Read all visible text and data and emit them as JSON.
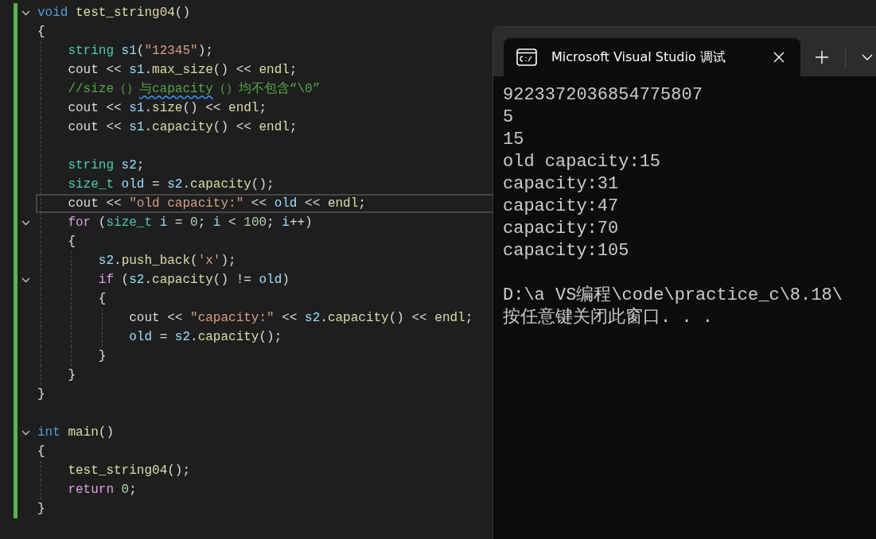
{
  "editor": {
    "lines": [
      {
        "kind": "code",
        "fold": true,
        "tokens": [
          {
            "kind": "keyword",
            "text": "void"
          },
          {
            "kind": "func",
            "text": " test_string04"
          },
          {
            "kind": "plain",
            "text": "()"
          }
        ]
      },
      {
        "kind": "code",
        "tokens": [
          {
            "kind": "plain",
            "text": "{"
          }
        ],
        "children": [
          {
            "kind": "code",
            "tokens": [
              {
                "kind": "type",
                "text": "string"
              },
              {
                "kind": "var",
                "text": " s1"
              },
              {
                "kind": "plain",
                "text": "("
              },
              {
                "kind": "str",
                "text": "\"12345\""
              },
              {
                "kind": "plain",
                "text": ");"
              }
            ]
          },
          {
            "kind": "code",
            "tokens": [
              {
                "kind": "plain",
                "text": "cout << "
              },
              {
                "kind": "var",
                "text": "s1"
              },
              {
                "kind": "plain",
                "text": "."
              },
              {
                "kind": "func",
                "text": "max_size"
              },
              {
                "kind": "plain",
                "text": "() << "
              },
              {
                "kind": "func",
                "text": "endl"
              },
              {
                "kind": "plain",
                "text": ";"
              }
            ]
          },
          {
            "kind": "code",
            "tokens": [
              {
                "kind": "comment",
                "text": "//size（）",
                "squiggle": false
              },
              {
                "kind": "comment",
                "text": "与capacity",
                "squiggle": true
              },
              {
                "kind": "comment",
                "text": "（）均不包含“\\0”",
                "squiggle": false
              }
            ]
          },
          {
            "kind": "code",
            "tokens": [
              {
                "kind": "plain",
                "text": "cout << "
              },
              {
                "kind": "var",
                "text": "s1"
              },
              {
                "kind": "plain",
                "text": "."
              },
              {
                "kind": "func",
                "text": "size"
              },
              {
                "kind": "plain",
                "text": "() << "
              },
              {
                "kind": "func",
                "text": "endl"
              },
              {
                "kind": "plain",
                "text": ";"
              }
            ]
          },
          {
            "kind": "code",
            "tokens": [
              {
                "kind": "plain",
                "text": "cout << "
              },
              {
                "kind": "var",
                "text": "s1"
              },
              {
                "kind": "plain",
                "text": "."
              },
              {
                "kind": "func",
                "text": "capacity"
              },
              {
                "kind": "plain",
                "text": "() << "
              },
              {
                "kind": "func",
                "text": "endl"
              },
              {
                "kind": "plain",
                "text": ";"
              }
            ]
          },
          {
            "kind": "blank"
          },
          {
            "kind": "code",
            "tokens": [
              {
                "kind": "type",
                "text": "string"
              },
              {
                "kind": "var",
                "text": " s2"
              },
              {
                "kind": "plain",
                "text": ";"
              }
            ]
          },
          {
            "kind": "code",
            "tokens": [
              {
                "kind": "type",
                "text": "size_t"
              },
              {
                "kind": "var",
                "text": " old"
              },
              {
                "kind": "plain",
                "text": " = "
              },
              {
                "kind": "var",
                "text": "s2"
              },
              {
                "kind": "plain",
                "text": "."
              },
              {
                "kind": "func",
                "text": "capacity"
              },
              {
                "kind": "plain",
                "text": "();"
              }
            ]
          },
          {
            "kind": "code",
            "current": true,
            "tokens": [
              {
                "kind": "plain",
                "text": "cout << "
              },
              {
                "kind": "str",
                "text": "\"old capacity:\""
              },
              {
                "kind": "plain",
                "text": " << "
              },
              {
                "kind": "var",
                "text": "old"
              },
              {
                "kind": "plain",
                "text": " << "
              },
              {
                "kind": "func",
                "text": "endl"
              },
              {
                "kind": "plain",
                "text": ";"
              }
            ]
          },
          {
            "kind": "code",
            "fold": true,
            "tokens": [
              {
                "kind": "ctrl",
                "text": "for"
              },
              {
                "kind": "plain",
                "text": " ("
              },
              {
                "kind": "type",
                "text": "size_t"
              },
              {
                "kind": "var",
                "text": " i"
              },
              {
                "kind": "plain",
                "text": " = "
              },
              {
                "kind": "num",
                "text": "0"
              },
              {
                "kind": "plain",
                "text": "; "
              },
              {
                "kind": "var",
                "text": "i"
              },
              {
                "kind": "plain",
                "text": " < "
              },
              {
                "kind": "num",
                "text": "100"
              },
              {
                "kind": "plain",
                "text": "; "
              },
              {
                "kind": "var",
                "text": "i"
              },
              {
                "kind": "plain",
                "text": "++)"
              }
            ]
          },
          {
            "kind": "code",
            "tokens": [
              {
                "kind": "plain",
                "text": "{"
              }
            ],
            "children": [
              {
                "kind": "code",
                "tokens": [
                  {
                    "kind": "var",
                    "text": "s2"
                  },
                  {
                    "kind": "plain",
                    "text": "."
                  },
                  {
                    "kind": "func",
                    "text": "push_back"
                  },
                  {
                    "kind": "plain",
                    "text": "("
                  },
                  {
                    "kind": "str",
                    "text": "'x'"
                  },
                  {
                    "kind": "plain",
                    "text": ");"
                  }
                ]
              },
              {
                "kind": "code",
                "fold": true,
                "tokens": [
                  {
                    "kind": "ctrl",
                    "text": "if"
                  },
                  {
                    "kind": "plain",
                    "text": " ("
                  },
                  {
                    "kind": "var",
                    "text": "s2"
                  },
                  {
                    "kind": "plain",
                    "text": "."
                  },
                  {
                    "kind": "func",
                    "text": "capacity"
                  },
                  {
                    "kind": "plain",
                    "text": "() != "
                  },
                  {
                    "kind": "var",
                    "text": "old"
                  },
                  {
                    "kind": "plain",
                    "text": ")"
                  }
                ]
              },
              {
                "kind": "code",
                "tokens": [
                  {
                    "kind": "plain",
                    "text": "{"
                  }
                ],
                "children": [
                  {
                    "kind": "code",
                    "tokens": [
                      {
                        "kind": "plain",
                        "text": "cout << "
                      },
                      {
                        "kind": "str",
                        "text": "\"capacity:\""
                      },
                      {
                        "kind": "plain",
                        "text": " << "
                      },
                      {
                        "kind": "var",
                        "text": "s2"
                      },
                      {
                        "kind": "plain",
                        "text": "."
                      },
                      {
                        "kind": "func",
                        "text": "capacity"
                      },
                      {
                        "kind": "plain",
                        "text": "() << "
                      },
                      {
                        "kind": "func",
                        "text": "endl"
                      },
                      {
                        "kind": "plain",
                        "text": ";"
                      }
                    ]
                  },
                  {
                    "kind": "code",
                    "tokens": [
                      {
                        "kind": "var",
                        "text": "old"
                      },
                      {
                        "kind": "plain",
                        "text": " = "
                      },
                      {
                        "kind": "var",
                        "text": "s2"
                      },
                      {
                        "kind": "plain",
                        "text": "."
                      },
                      {
                        "kind": "func",
                        "text": "capacity"
                      },
                      {
                        "kind": "plain",
                        "text": "();"
                      }
                    ]
                  }
                ]
              },
              {
                "kind": "code",
                "tokens": [
                  {
                    "kind": "plain",
                    "text": "}"
                  }
                ]
              }
            ]
          },
          {
            "kind": "code",
            "tokens": [
              {
                "kind": "plain",
                "text": "}"
              }
            ]
          }
        ]
      },
      {
        "kind": "code",
        "tokens": [
          {
            "kind": "plain",
            "text": "}"
          }
        ]
      },
      {
        "kind": "blank"
      },
      {
        "kind": "code",
        "fold": true,
        "tokens": [
          {
            "kind": "keyword",
            "text": "int"
          },
          {
            "kind": "func",
            "text": " main"
          },
          {
            "kind": "plain",
            "text": "()"
          }
        ]
      },
      {
        "kind": "code",
        "tokens": [
          {
            "kind": "plain",
            "text": "{"
          }
        ],
        "children": [
          {
            "kind": "code",
            "tokens": [
              {
                "kind": "func",
                "text": "test_string04"
              },
              {
                "kind": "plain",
                "text": "();"
              }
            ]
          },
          {
            "kind": "code",
            "tokens": [
              {
                "kind": "ctrl",
                "text": "return"
              },
              {
                "kind": "num",
                "text": " 0"
              },
              {
                "kind": "plain",
                "text": ";"
              }
            ]
          }
        ]
      },
      {
        "kind": "code",
        "tokens": [
          {
            "kind": "plain",
            "text": "}"
          }
        ]
      }
    ]
  },
  "terminal": {
    "tab_title": "Microsoft Visual Studio 调试",
    "output": [
      {
        "kind": "line",
        "text": "9223372036854775807"
      },
      {
        "kind": "line",
        "text": "5"
      },
      {
        "kind": "line",
        "text": "15"
      },
      {
        "kind": "line",
        "text": "old capacity:15"
      },
      {
        "kind": "line",
        "text": "capacity:31"
      },
      {
        "kind": "line",
        "text": "capacity:47"
      },
      {
        "kind": "line",
        "text": "capacity:70"
      },
      {
        "kind": "line",
        "text": "capacity:105"
      },
      {
        "kind": "blank"
      },
      {
        "kind": "line",
        "text": "D:\\a VS编程\\code\\practice_c\\8.18\\"
      },
      {
        "kind": "line",
        "text": "按任意键关闭此窗口. . ."
      }
    ]
  }
}
